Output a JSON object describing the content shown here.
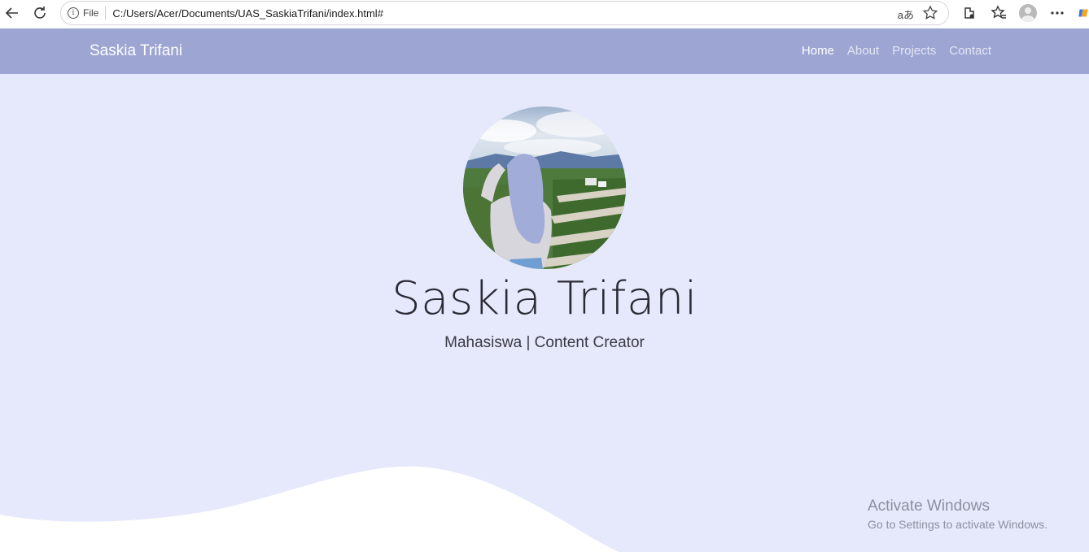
{
  "browser": {
    "file_label": "File",
    "url": "C:/Users/Acer/Documents/UAS_SaskiaTrifani/index.html#",
    "read_aloud_label": "aあ"
  },
  "navbar": {
    "brand": "Saskia Trifani",
    "links": [
      {
        "label": "Home",
        "active": true
      },
      {
        "label": "About",
        "active": false
      },
      {
        "label": "Projects",
        "active": false
      },
      {
        "label": "Contact",
        "active": false
      }
    ]
  },
  "hero": {
    "name": "Saskia Trifani",
    "subtitle": "Mahasiswa | Content Creator"
  },
  "watermark": {
    "title": "Activate Windows",
    "subtitle": "Go to Settings to activate Windows."
  },
  "colors": {
    "navbar_bg": "#9da5d3",
    "page_bg": "#e6e9fb",
    "wave": "#ffffff"
  }
}
